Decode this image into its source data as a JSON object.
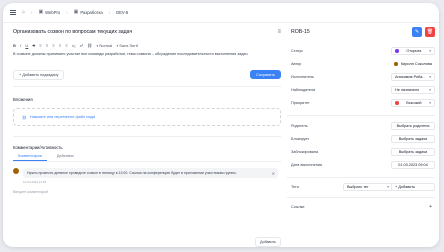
{
  "breadcrumb": {
    "items": [
      "WebPro",
      "Разработка",
      "DEV-6"
    ]
  },
  "editor": {
    "title": "Организовать созвон по вопросам текущих задач",
    "toolbar": [
      "B",
      "I",
      "U",
      "S",
      "≡",
      "≡",
      "≡",
      "≡",
      "≡",
      "x₂",
      "x²",
      "🔗",
      "Normal",
      "Sans Serif"
    ],
    "heading_select": "Normal",
    "font_select": "Sans Serif",
    "body": "В созвоне должны принимать участие все команды разработки, тема созвона – обсуждение последовательности выполнения задач."
  },
  "actions": {
    "add_subtask": "+ Добавить подзадачу",
    "save": "Сохранить"
  },
  "attachments": {
    "title": "Вложения",
    "drop_label": "Нажмите или перетяните файл сюда"
  },
  "comments": {
    "title": "Комментарии/Активность",
    "tabs": [
      "Комментарии",
      "Действия"
    ],
    "items": [
      {
        "text": "Нужно провести дневное проведите созвон в пятницу в 12:00. Ссылка на конференцию будет в приложении участникам группы.",
        "time": "12.03.2024 14:54"
      }
    ],
    "input_placeholder": "Введите комментарий",
    "add_button": "Добавить"
  },
  "task": {
    "id": "ROB-15",
    "fields": [
      {
        "label": "Статус",
        "value": "Открыта",
        "dot": "#7c3aed",
        "type": "select"
      },
      {
        "label": "Автор",
        "value": "Кирилл Соколова",
        "dot": "#a16207",
        "type": "plain"
      },
      {
        "label": "Исполнитель",
        "value": "Анисимов Роба...",
        "dot": "",
        "type": "select"
      },
      {
        "label": "Наблюдатели",
        "value": "Не назначено",
        "dot": "",
        "type": "select"
      },
      {
        "label": "Приоритет",
        "value": "Высокий",
        "dot": "#ef4444",
        "type": "select"
      }
    ],
    "links": [
      {
        "label": "Родитель",
        "value": "Выбрать родителя"
      },
      {
        "label": "Блокирует",
        "value": "Выбрать задачи"
      },
      {
        "label": "Заблокирована",
        "value": "Выбрать задачи"
      },
      {
        "label": "Дата выполнения",
        "value": "01.03.2023 09:04"
      }
    ],
    "tags": {
      "label": "Теги",
      "select": "Выбрать тег",
      "add": "+ Добавить"
    },
    "links_section": {
      "label": "Ссылки",
      "add": "+"
    }
  },
  "colors": {
    "accent": "#3b82f6",
    "danger": "#ef4444"
  }
}
